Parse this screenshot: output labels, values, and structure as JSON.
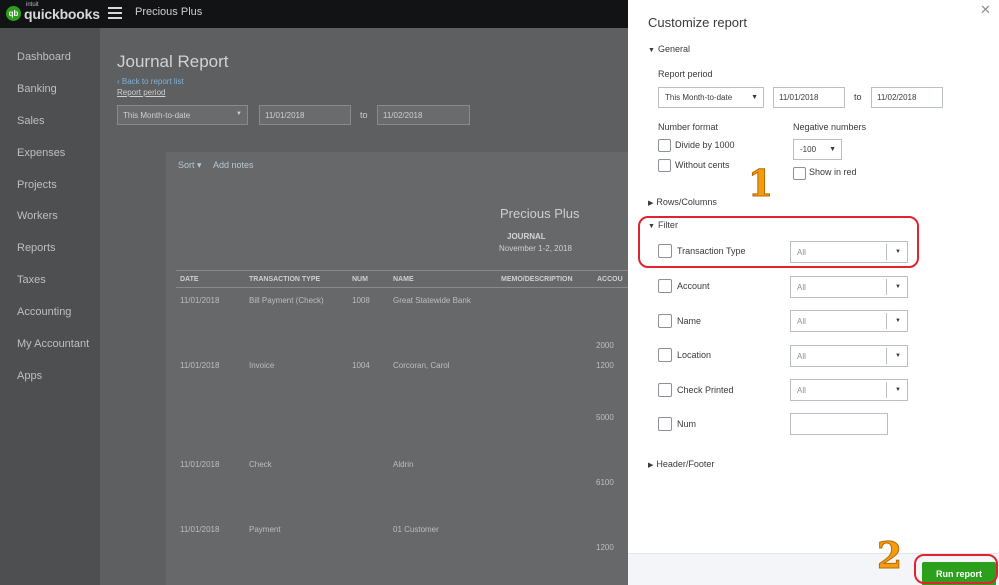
{
  "app": {
    "brand_small": "intuit",
    "brand": "quickbooks",
    "company": "Precious Plus"
  },
  "sidebar": {
    "items": [
      {
        "label": "Dashboard"
      },
      {
        "label": "Banking"
      },
      {
        "label": "Sales"
      },
      {
        "label": "Expenses"
      },
      {
        "label": "Projects"
      },
      {
        "label": "Workers"
      },
      {
        "label": "Reports"
      },
      {
        "label": "Taxes"
      },
      {
        "label": "Accounting"
      },
      {
        "label": "My Accountant"
      },
      {
        "label": "Apps"
      }
    ]
  },
  "report": {
    "title": "Journal Report",
    "back_link": "Back to report list",
    "period_label": "Report period",
    "period_value": "This Month-to-date",
    "from": "11/01/2018",
    "to_label": "to",
    "to": "11/02/2018",
    "sort": "Sort",
    "add_notes": "Add notes",
    "company": "Precious Plus",
    "name": "JOURNAL",
    "range": "November 1-2, 2018",
    "columns": [
      "DATE",
      "TRANSACTION TYPE",
      "NUM",
      "NAME",
      "MEMO/DESCRIPTION",
      "ACCOU"
    ],
    "rows": [
      {
        "date": "11/01/2018",
        "type": "Bill Payment (Check)",
        "num": "1008",
        "name": "Great Statewide Bank",
        "acct": "2000"
      },
      {
        "date": "11/01/2018",
        "type": "Invoice",
        "num": "1004",
        "name": "Corcoran, Carol",
        "acct": "1200",
        "acct2": "5000"
      },
      {
        "date": "11/01/2018",
        "type": "Check",
        "num": "",
        "name": "Aldrin",
        "acct": "6100"
      },
      {
        "date": "11/01/2018",
        "type": "Payment",
        "num": "",
        "name": "01 Customer",
        "acct": "1200"
      }
    ]
  },
  "panel": {
    "title": "Customize report",
    "close": "✕",
    "general": "General",
    "report_period": "Report period",
    "period_value": "This Month-to-date",
    "from": "11/01/2018",
    "to_label": "to",
    "to": "11/02/2018",
    "number_format": "Number format",
    "divide_by_1000": "Divide by 1000",
    "without_cents": "Without cents",
    "negative_numbers": "Negative numbers",
    "negative_value": "-100",
    "show_in_red": "Show in red",
    "rows_columns": "Rows/Columns",
    "filter": "Filter",
    "filters": [
      {
        "label": "Transaction Type",
        "value": "All"
      },
      {
        "label": "Account",
        "value": "All"
      },
      {
        "label": "Name",
        "value": "All"
      },
      {
        "label": "Location",
        "value": "All"
      },
      {
        "label": "Check Printed",
        "value": "All"
      },
      {
        "label": "Num",
        "value": ""
      }
    ],
    "header_footer": "Header/Footer",
    "run_report": "Run report"
  },
  "annotations": {
    "first": "1",
    "second": "2",
    "color": "#e0242f",
    "number_color": "#f39c12"
  },
  "colors": {
    "accent": "#2ca01c",
    "topbar": "#111315"
  }
}
